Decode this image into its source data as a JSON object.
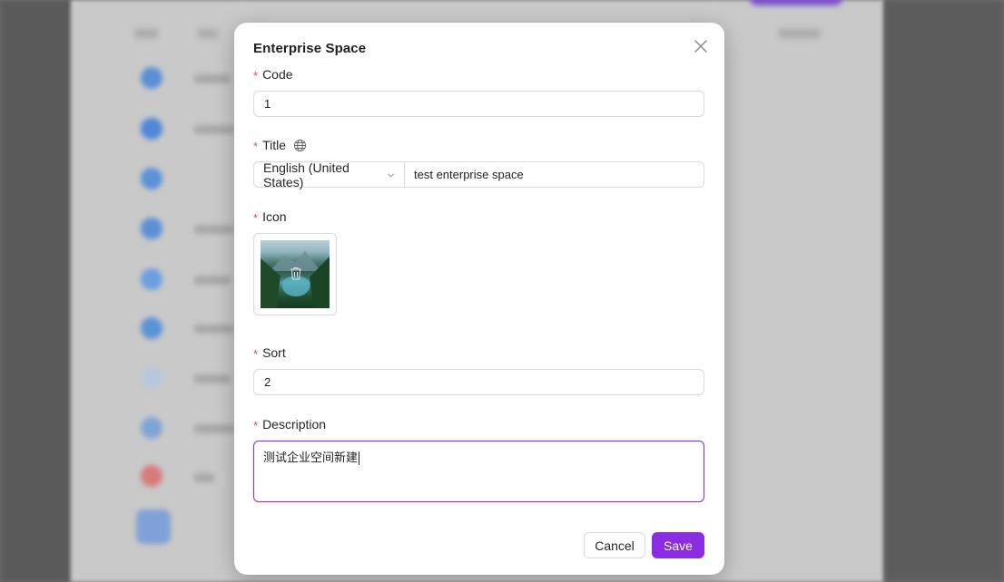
{
  "modal": {
    "title": "Enterprise Space",
    "close_icon": "close-icon"
  },
  "form": {
    "code": {
      "label": "Code",
      "required_mark": "*",
      "value": "1"
    },
    "title": {
      "label": "Title",
      "required_mark": "*",
      "language_icon": "globe-icon",
      "language": "English (United States)",
      "value": "test enterprise space"
    },
    "icon": {
      "label": "Icon",
      "required_mark": "*",
      "delete_icon": "trash-icon"
    },
    "sort": {
      "label": "Sort",
      "required_mark": "*",
      "value": "2"
    },
    "description": {
      "label": "Description",
      "required_mark": "*",
      "value": "测试企业空间新建"
    }
  },
  "footer": {
    "cancel_label": "Cancel",
    "save_label": "Save"
  },
  "colors": {
    "accent": "#8b2be2",
    "required": "#e5484d",
    "border": "#d9d9d9"
  }
}
